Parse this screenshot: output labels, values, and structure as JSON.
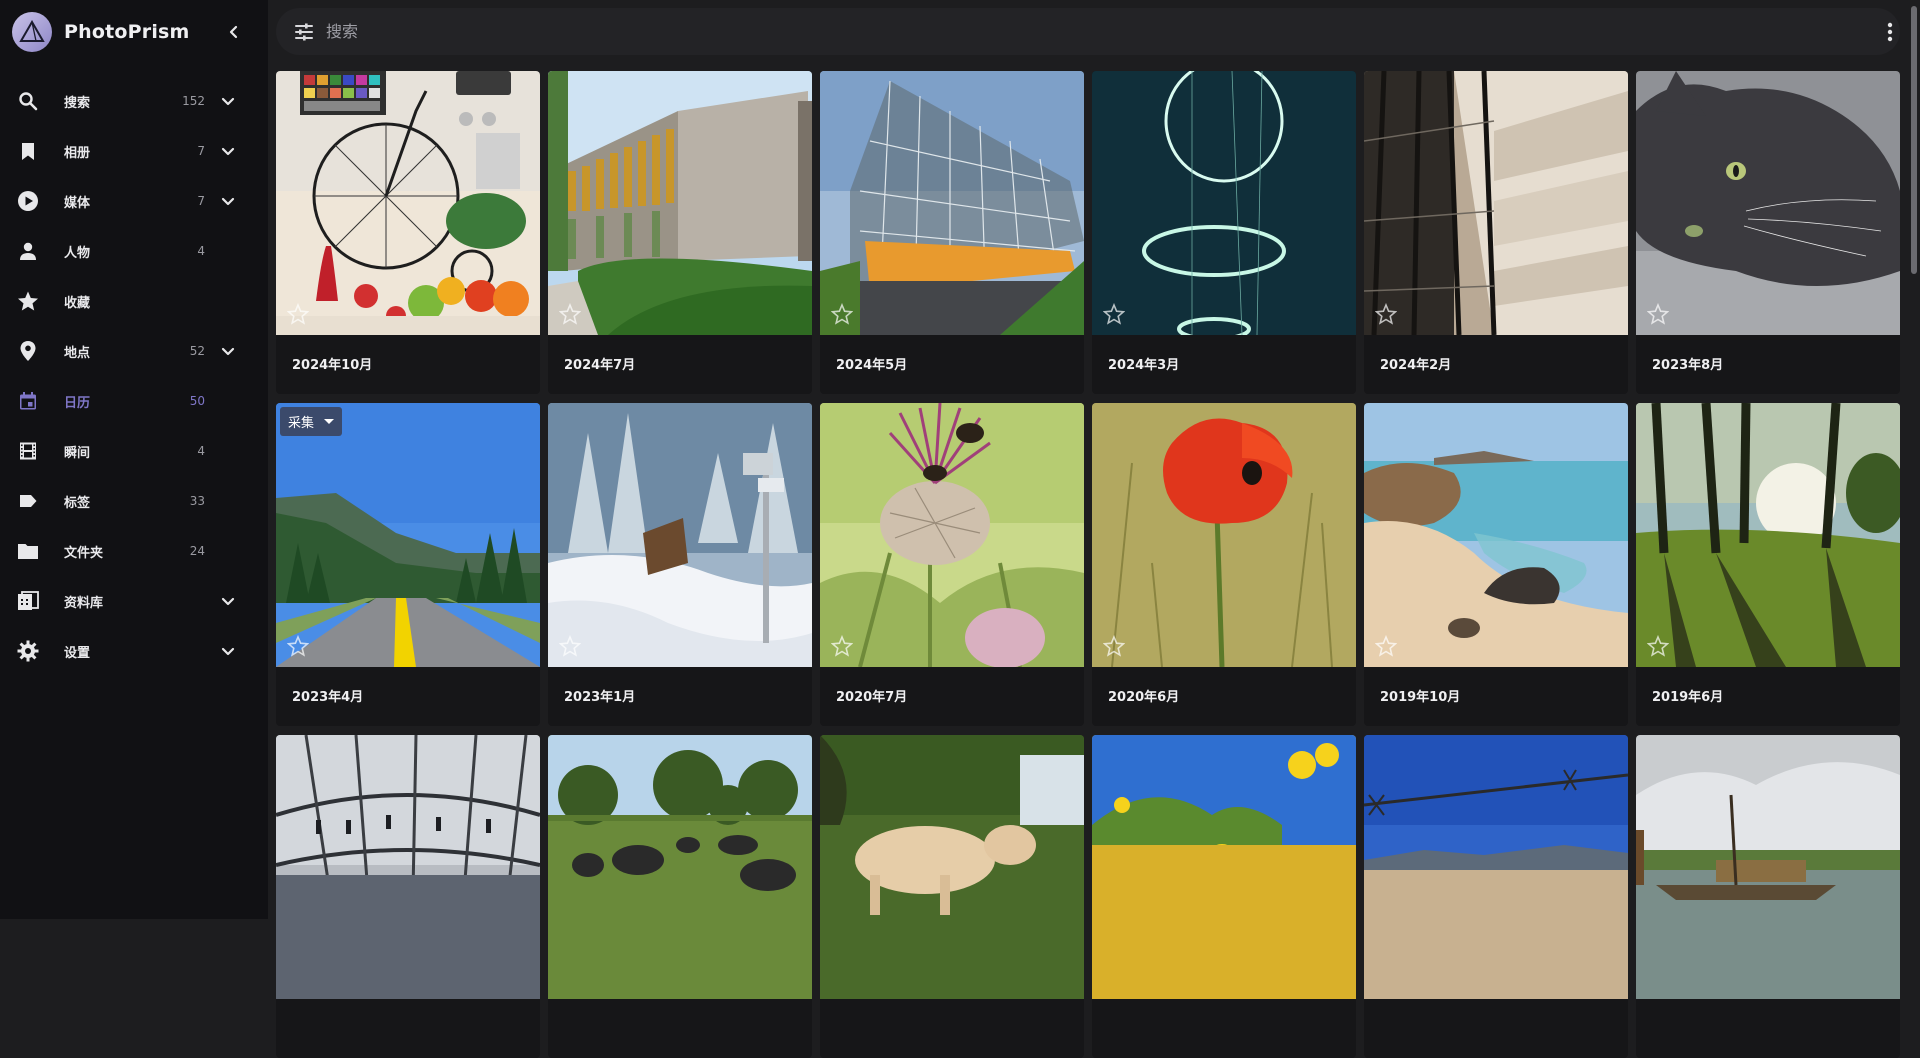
{
  "app": {
    "name": "PhotoPrism"
  },
  "search": {
    "placeholder": "搜索"
  },
  "sidebar": {
    "items": [
      {
        "label": "搜索",
        "count": "152",
        "icon": "search-icon",
        "expandable": true
      },
      {
        "label": "相册",
        "count": "7",
        "icon": "bookmark-icon",
        "expandable": true
      },
      {
        "label": "媒体",
        "count": "7",
        "icon": "play-circle-icon",
        "expandable": true
      },
      {
        "label": "人物",
        "count": "4",
        "icon": "person-icon",
        "expandable": false
      },
      {
        "label": "收藏",
        "count": "",
        "icon": "star-icon",
        "expandable": false
      },
      {
        "label": "地点",
        "count": "52",
        "icon": "map-pin-icon",
        "expandable": true
      },
      {
        "label": "日历",
        "count": "50",
        "icon": "calendar-icon",
        "expandable": false,
        "active": true
      },
      {
        "label": "瞬间",
        "count": "4",
        "icon": "film-icon",
        "expandable": false
      },
      {
        "label": "标签",
        "count": "33",
        "icon": "label-icon",
        "expandable": false
      },
      {
        "label": "文件夹",
        "count": "24",
        "icon": "folder-icon",
        "expandable": false
      },
      {
        "label": "资料库",
        "count": "",
        "icon": "library-icon",
        "expandable": true
      },
      {
        "label": "设置",
        "count": "",
        "icon": "gear-icon",
        "expandable": true
      }
    ]
  },
  "album_menu": {
    "label": "采集"
  },
  "cards": [
    {
      "title": "2024年10月"
    },
    {
      "title": "2024年7月"
    },
    {
      "title": "2024年5月"
    },
    {
      "title": "2024年3月"
    },
    {
      "title": "2024年2月"
    },
    {
      "title": "2023年8月"
    },
    {
      "title": "2023年4月"
    },
    {
      "title": "2023年1月"
    },
    {
      "title": "2020年7月"
    },
    {
      "title": "2020年6月"
    },
    {
      "title": "2019年10月"
    },
    {
      "title": "2019年6月"
    },
    {
      "title": ""
    },
    {
      "title": ""
    },
    {
      "title": ""
    },
    {
      "title": ""
    },
    {
      "title": ""
    },
    {
      "title": ""
    }
  ],
  "colors": {
    "accent": "#7f76c7",
    "sidebar_bg": "#111114",
    "content_bg": "#1d1d1f",
    "card_bg": "#161618",
    "chip_bg": "#3b4a6b"
  }
}
